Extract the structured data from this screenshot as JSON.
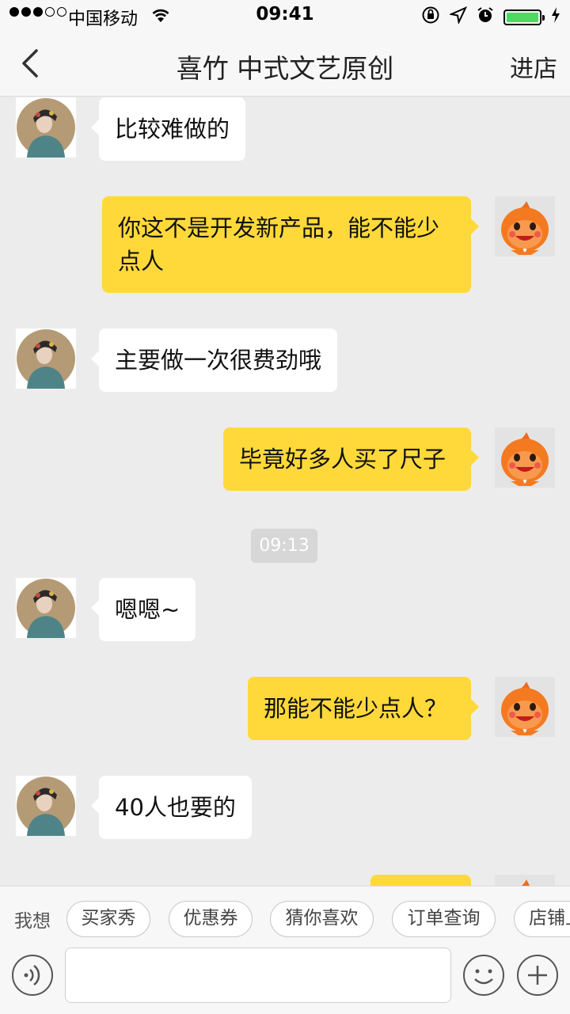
{
  "status_bar": {
    "carrier": "中国移动",
    "time": "09:41",
    "signal_dots_filled": 3,
    "signal_dots_total": 5,
    "battery_level": 0.9,
    "icons": [
      "wifi-icon",
      "orientation-lock-icon",
      "location-icon",
      "alarm-icon",
      "battery-icon",
      "charging-icon"
    ]
  },
  "nav": {
    "title": "喜竹 中式文艺原创",
    "enter_store": "进店",
    "back_icon": "chevron-left-icon"
  },
  "messages": [
    {
      "from": "shop",
      "text": "比较难做的"
    },
    {
      "from": "me",
      "line1": "你这不是开发新产品，能不能少",
      "line2": "点人"
    },
    {
      "from": "shop",
      "text": "主要做一次很费劲哦"
    },
    {
      "from": "me",
      "text": "毕竟好多人买了尺子"
    },
    {
      "from": "shop",
      "text": "嗯嗯~"
    },
    {
      "from": "me",
      "text": "那能不能少点人？"
    },
    {
      "from": "shop",
      "text": "40人也要的"
    }
  ],
  "timestamp": "09:13",
  "quick_bar": {
    "label": "我想",
    "chips": [
      "买家秀",
      "优惠券",
      "猜你喜欢",
      "订单查询",
      "店铺上"
    ]
  },
  "input_bar": {
    "text_value": "",
    "icons": [
      "voice-icon",
      "emoji-icon",
      "plus-icon"
    ]
  },
  "colors": {
    "background": "#ececec",
    "outgoing_bubble": "#ffd93a",
    "incoming_bubble": "#ffffff",
    "battery_fill": "#4cd964"
  }
}
